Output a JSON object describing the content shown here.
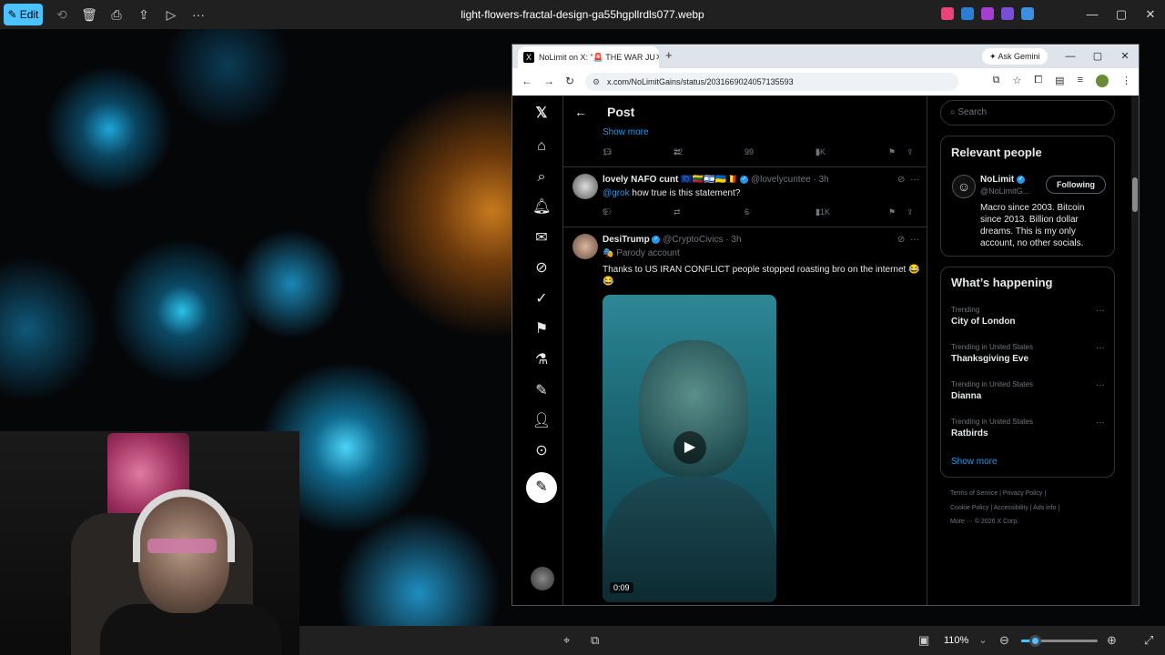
{
  "viewer": {
    "edit_label": "Edit",
    "file_title": "light-flowers-fractal-design-ga55hgpllrdls077.webp",
    "zoom": "110%",
    "zoom_fraction": 0.18
  },
  "browser": {
    "tab_title": "NoLimit on X: \"🚨 THE WAR JU",
    "ask_gemini": "Ask Gemini",
    "url": "x.com/NoLimitGains/status/2031669024057135593"
  },
  "x": {
    "header_title": "Post",
    "show_more": "Show more",
    "top_actions": {
      "replies": "13",
      "reposts": "22",
      "likes": "99",
      "views": "5K"
    },
    "tweets": [
      {
        "name": "lovely NAFO cunt 🇪🇺🇱🇹🇮🇱🇺🇦🇧🇪",
        "handle": "@lovelycuntee",
        "time": "· 3h",
        "mention": "@grok",
        "text": " how true is this statement?",
        "replies": "9",
        "reposts": "",
        "likes": "6",
        "views": "21K"
      },
      {
        "name": "DesiTrump",
        "handle": "@CryptoCivics",
        "time": "· 3h",
        "parody": "🎭 Parody account",
        "text": "Thanks to US IRAN CONFLICT people stopped roasting bro on the internet 😂😂",
        "video_time": "0:09"
      }
    ]
  },
  "sidebar": {
    "search_placeholder": "Search",
    "relevant_title": "Relevant people",
    "person": {
      "name": "NoLimit",
      "handle": "@NoLimitG...",
      "follow_label": "Following",
      "bio": "Macro since 2003. Bitcoin since 2013. Billion dollar dreams. This is my only account, no other socials."
    },
    "happening_title": "What’s happening",
    "trends": [
      {
        "category": "Trending",
        "name": "City of London"
      },
      {
        "category": "Trending in United States",
        "name": "Thanksgiving Eve"
      },
      {
        "category": "Trending in United States",
        "name": "Dianna"
      },
      {
        "category": "Trending in United States",
        "name": "Ratbirds"
      }
    ],
    "show_more": "Show more",
    "footer1": "Terms of Service  |  Privacy Policy  |",
    "footer2": "Cookie Policy  |  Accessibility  |  Ads info  |",
    "footer3": "More ···     © 2026 X Corp."
  }
}
